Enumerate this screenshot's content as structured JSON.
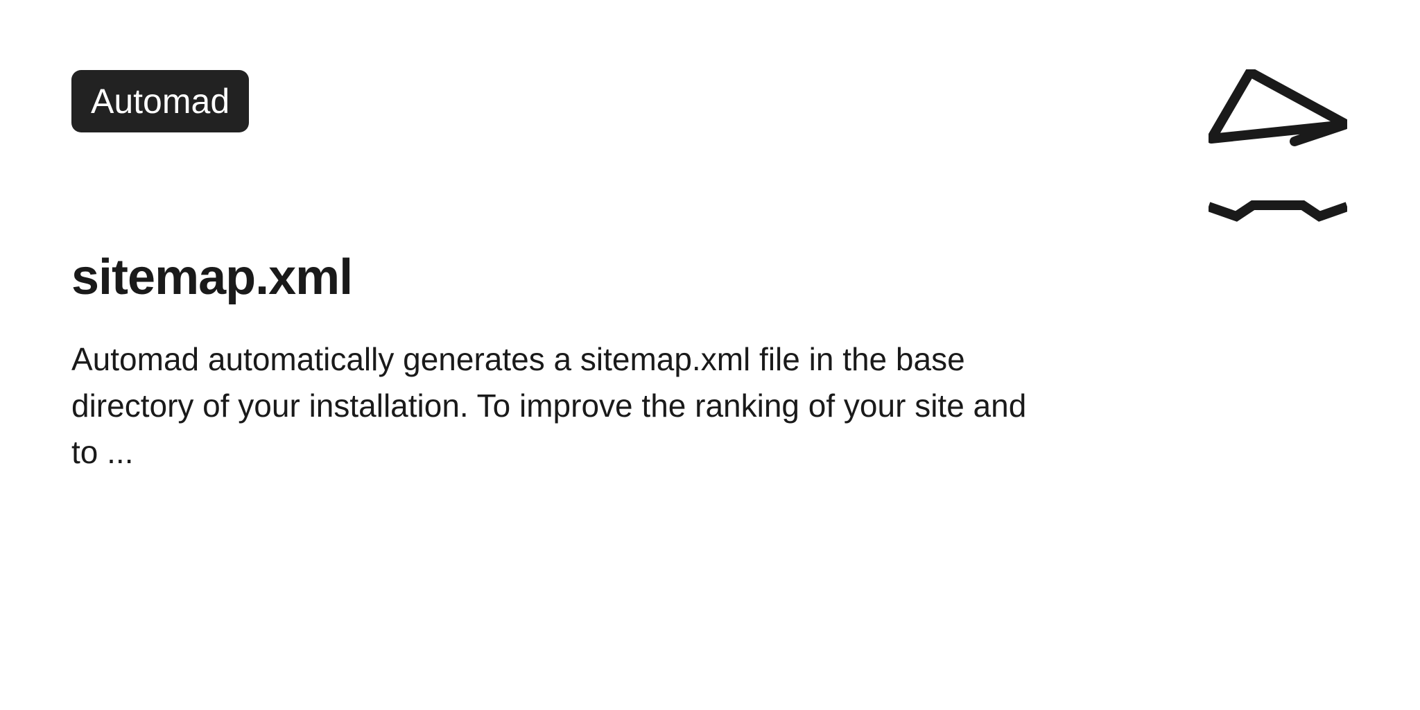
{
  "badge": {
    "label": "Automad"
  },
  "heading": "sitemap.xml",
  "description": "Automad automatically generates a sitemap.xml file in the base directory of your installation. To improve the ranking of your site and to ..."
}
